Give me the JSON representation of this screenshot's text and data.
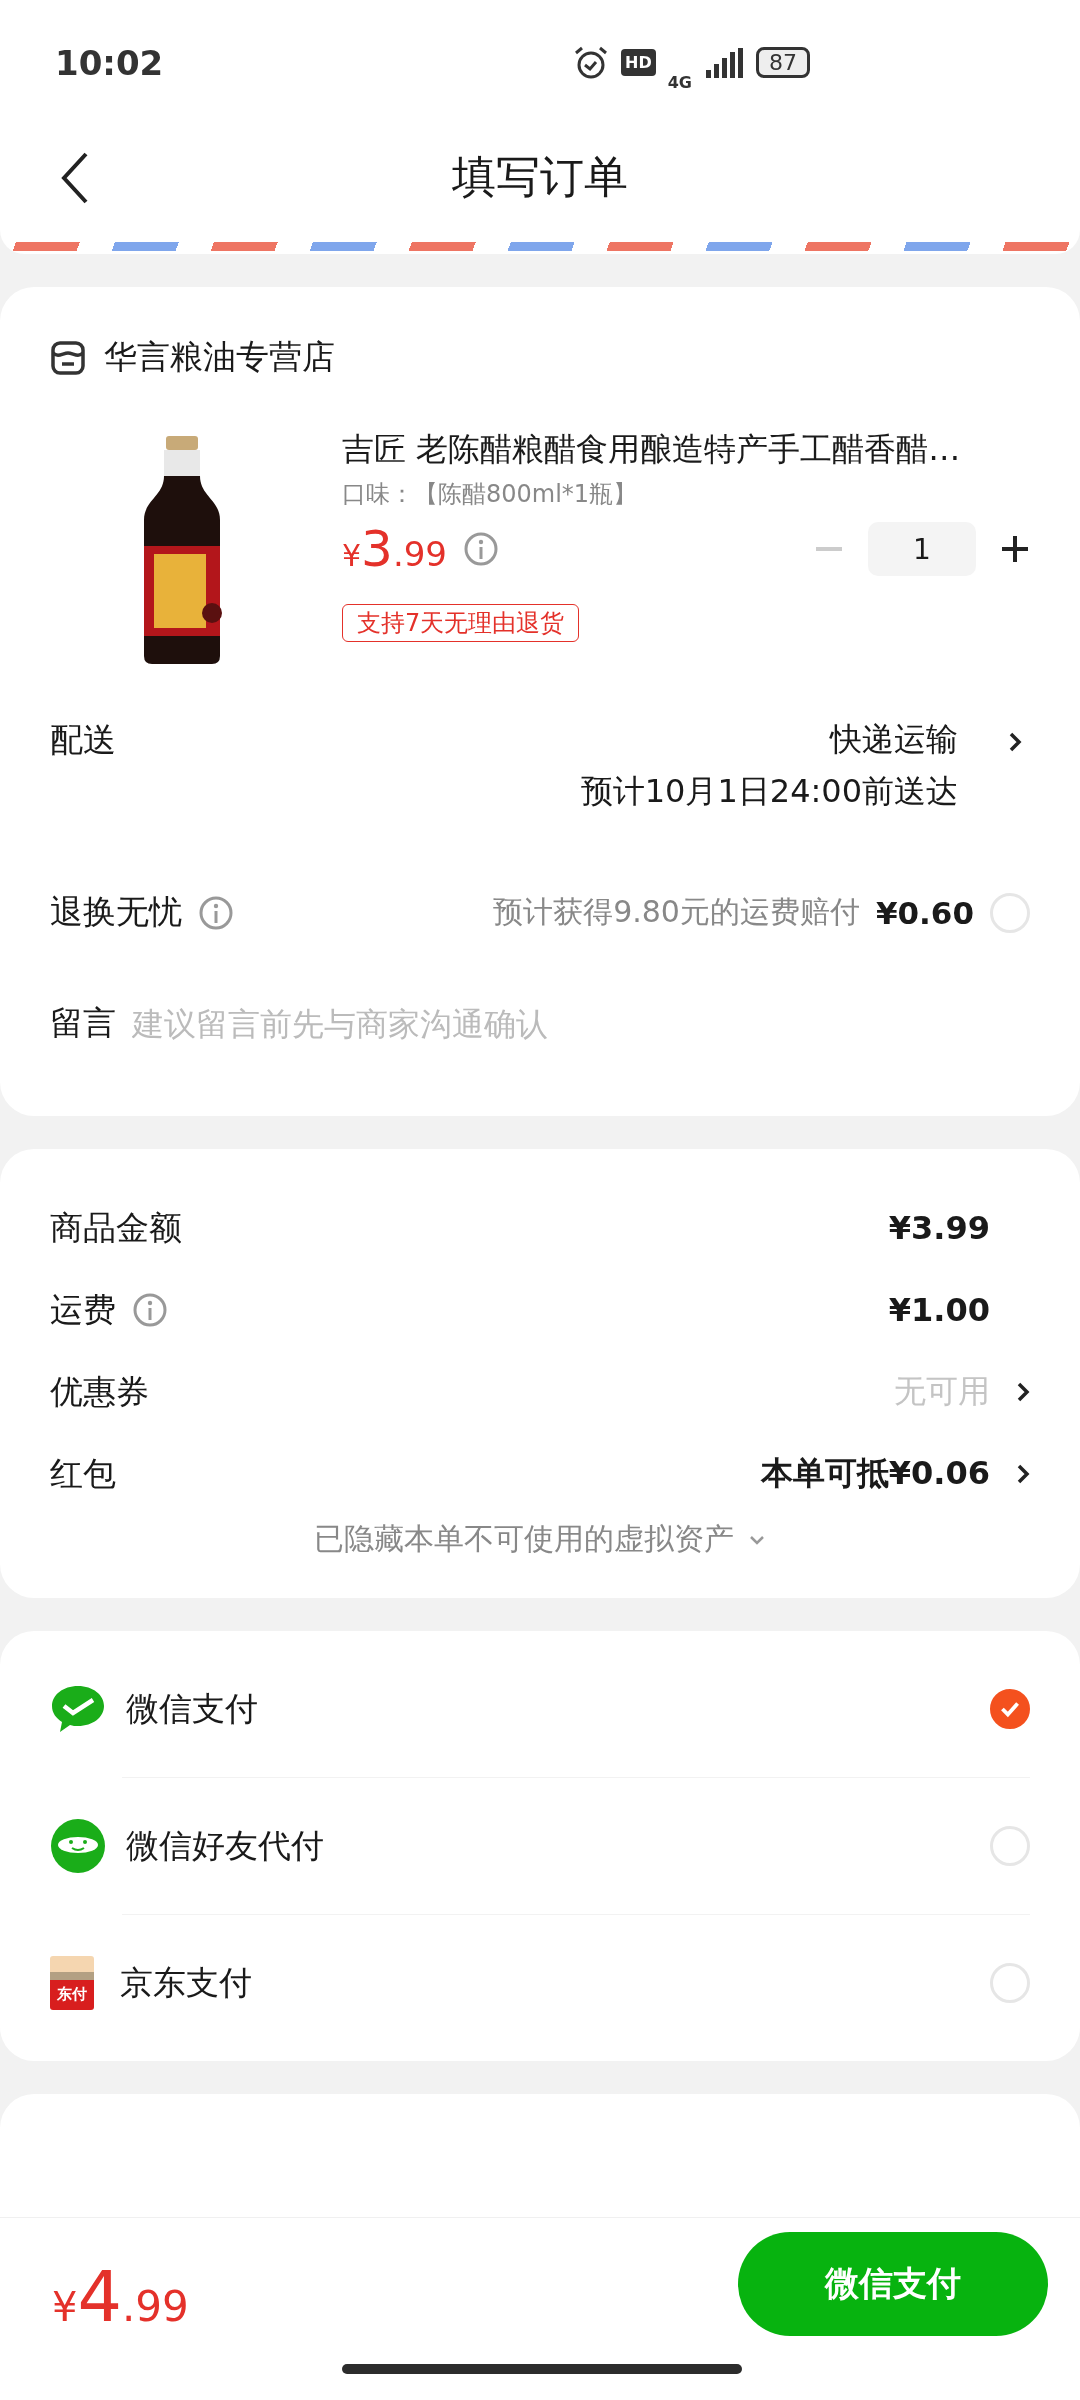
{
  "status_bar": {
    "time": "10:02",
    "hd": "HD",
    "network": "4G",
    "battery": "87"
  },
  "header": {
    "title": "填写订单"
  },
  "shop": {
    "name": "华言粮油专营店"
  },
  "product": {
    "title": "吉匠 老陈醋粮醋食用酿造特产手工醋香醋…",
    "spec": "口味：【陈醋800ml*1瓶】",
    "price": {
      "currency": "¥",
      "integer": "3",
      "decimals": ".99"
    },
    "quantity": "1",
    "minus_disabled": true,
    "badge": "支持7天无理由退货"
  },
  "delivery": {
    "label": "配送",
    "method": "快递运输",
    "eta": "预计10月1日24:00前送达"
  },
  "return_insurance": {
    "label": "退换无忧",
    "note": "预计获得9.80元的运费赔付",
    "price": "¥0.60",
    "checked": false
  },
  "message": {
    "label": "留言",
    "placeholder": "建议留言前先与商家沟通确认"
  },
  "summary": {
    "rows": [
      {
        "label": "商品金额",
        "value": "¥3.99",
        "info": false,
        "arrow": false,
        "muted": false
      },
      {
        "label": "运费",
        "value": "¥1.00",
        "info": true,
        "arrow": false,
        "muted": false
      },
      {
        "label": "优惠券",
        "value": "无可用",
        "info": false,
        "arrow": true,
        "muted": true
      },
      {
        "label": "红包",
        "value": "本单可抵¥0.06",
        "info": false,
        "arrow": true,
        "muted": false
      }
    ],
    "hidden_note": "已隐藏本单不可使用的虚拟资产"
  },
  "payment": {
    "methods": [
      {
        "kind": "wechat",
        "name": "微信支付",
        "selected": true
      },
      {
        "kind": "friend",
        "name": "微信好友代付",
        "selected": false
      },
      {
        "kind": "card",
        "name": "京东支付",
        "icon_label": "东付",
        "selected": false
      }
    ]
  },
  "bottom_bar": {
    "total": {
      "currency": "¥",
      "integer": "4",
      "decimals": ".99"
    },
    "pay_button": "微信支付"
  }
}
